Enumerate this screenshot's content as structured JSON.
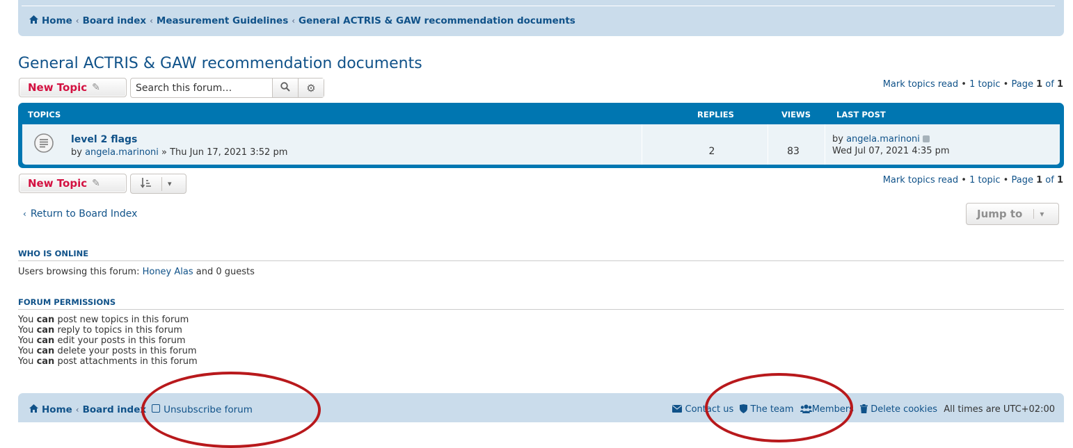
{
  "breadcrumb": {
    "items": [
      "Home",
      "Board index",
      "Measurement Guidelines",
      "General ACTRIS & GAW recommendation documents"
    ]
  },
  "forum": {
    "title": "General ACTRIS & GAW recommendation documents"
  },
  "toolbar": {
    "new_topic_label": "New Topic",
    "search_placeholder": "Search this forum…"
  },
  "pagination": {
    "mark_read": "Mark topics read",
    "sep": " • ",
    "topic_count": "1 topic",
    "page_prefix": "Page",
    "page_current": "1",
    "page_of": "of",
    "page_total": "1"
  },
  "topics": {
    "headers": {
      "topics": "TOPICS",
      "replies": "REPLIES",
      "views": "VIEWS",
      "last_post": "LAST POST"
    },
    "rows": [
      {
        "title": "level 2 flags",
        "by_prefix": "by",
        "author": "angela.marinoni",
        "raquo": " » ",
        "posted": "Thu Jun 17, 2021 3:52 pm",
        "replies": "2",
        "views": "83",
        "last_by_prefix": "by",
        "last_author": "angela.marinoni",
        "last_time": "Wed Jul 07, 2021 4:35 pm"
      }
    ]
  },
  "navigation": {
    "return_label": "Return to Board Index",
    "jump_label": "Jump to"
  },
  "who_is_online": {
    "heading": "WHO IS ONLINE",
    "text_prefix": "Users browsing this forum: ",
    "user": "Honey Alas",
    "text_suffix": " and 0 guests"
  },
  "permissions": {
    "heading": "FORUM PERMISSIONS",
    "prefix": "You",
    "can": "can",
    "lines": [
      "post new topics in this forum",
      "reply to topics in this forum",
      "edit your posts in this forum",
      "delete your posts in this forum",
      "post attachments in this forum"
    ]
  },
  "footer": {
    "home": "Home",
    "board_index": "Board index",
    "unsubscribe": "Unsubscribe forum",
    "contact": "Contact us",
    "team": "The team",
    "members": "Members",
    "delete_cookies": "Delete cookies",
    "times": "All times are UTC+02:00"
  },
  "colors": {
    "link": "#105289",
    "accent_red": "#d31141",
    "table_blue": "#0076b1",
    "nav_bg": "#cadceb",
    "annotation_circle": "#b8191c"
  },
  "icons": {
    "home": "home-icon",
    "search": "search-icon",
    "settings": "gear-icon",
    "pencil": "pencil-icon",
    "topic": "topic-read-icon",
    "sort": "sort-icon",
    "envelope": "envelope-icon",
    "shield": "shield-icon",
    "members": "members-icon",
    "trash": "trash-icon"
  }
}
